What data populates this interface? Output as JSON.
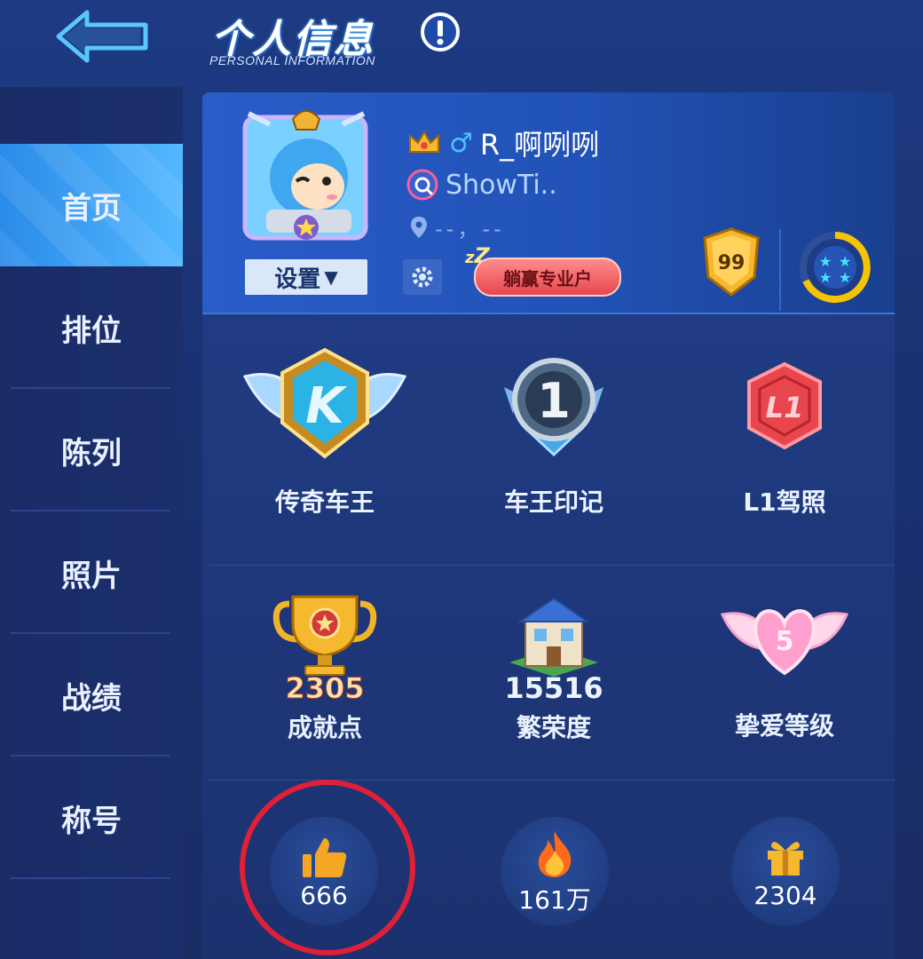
{
  "header": {
    "title": "个人信息",
    "subtitle": "PERSONAL INFORMATION",
    "back_icon": "back-arrow-icon",
    "alert_icon": "exclamation-icon"
  },
  "sidebar": {
    "items": [
      {
        "label": "首页",
        "active": true
      },
      {
        "label": "排位",
        "active": false
      },
      {
        "label": "陈列",
        "active": false
      },
      {
        "label": "照片",
        "active": false
      },
      {
        "label": "战绩",
        "active": false
      },
      {
        "label": "称号",
        "active": false
      }
    ]
  },
  "profile": {
    "username": "R_啊咧咧",
    "gender_icon": "♂",
    "showti": "ShowTi..",
    "location": "--，--",
    "settings_label": "设置",
    "tag": "躺赢专业户",
    "level": "99"
  },
  "achievements": [
    {
      "label": "传奇车王",
      "icon": "legend-king-badge-icon"
    },
    {
      "label": "车王印记",
      "icon": "king-mark-badge-icon"
    },
    {
      "label": "L1驾照",
      "icon": "l1-license-icon",
      "badge_text": "L1"
    }
  ],
  "stats": [
    {
      "label": "成就点",
      "value": "2305",
      "icon": "trophy-icon"
    },
    {
      "label": "繁荣度",
      "value": "15516",
      "icon": "house-icon"
    },
    {
      "label": "挚爱等级",
      "value": "5",
      "icon": "winged-heart-icon"
    }
  ],
  "counters": [
    {
      "value": "666",
      "icon": "thumbs-up-icon"
    },
    {
      "value": "161万",
      "icon": "flame-icon"
    },
    {
      "value": "2304",
      "icon": "gift-icon"
    }
  ],
  "colors": {
    "accent": "#2b8be8",
    "highlight_circle": "#e11f37",
    "gold": "#f5b82e"
  }
}
